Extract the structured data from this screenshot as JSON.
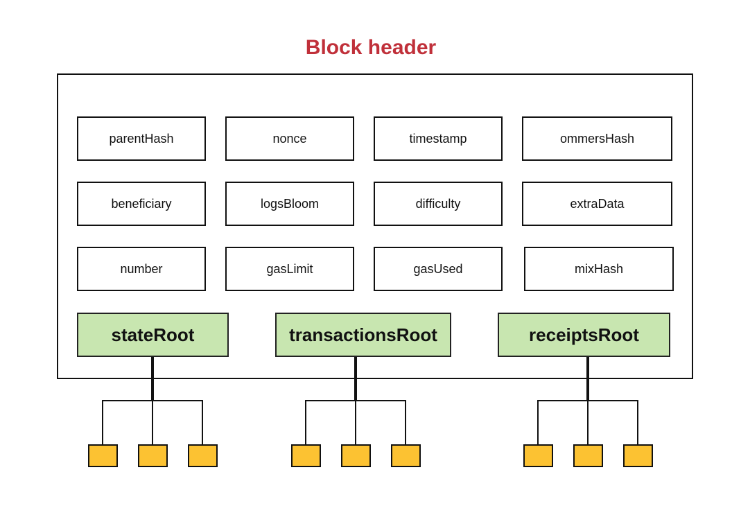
{
  "title": "Block header",
  "colors": {
    "title": "#c0303a",
    "root_fill": "#c8e6b0",
    "leaf_fill": "#fcc232"
  },
  "fields": [
    [
      "parentHash",
      "nonce",
      "timestamp",
      "ommersHash"
    ],
    [
      "beneficiary",
      "logsBloom",
      "difficulty",
      "extraData"
    ],
    [
      "number",
      "gasLimit",
      "gasUsed",
      "mixHash"
    ]
  ],
  "roots": [
    {
      "label": "stateRoot",
      "children": 3
    },
    {
      "label": "transactionsRoot",
      "children": 3
    },
    {
      "label": "receiptsRoot",
      "children": 3
    }
  ]
}
